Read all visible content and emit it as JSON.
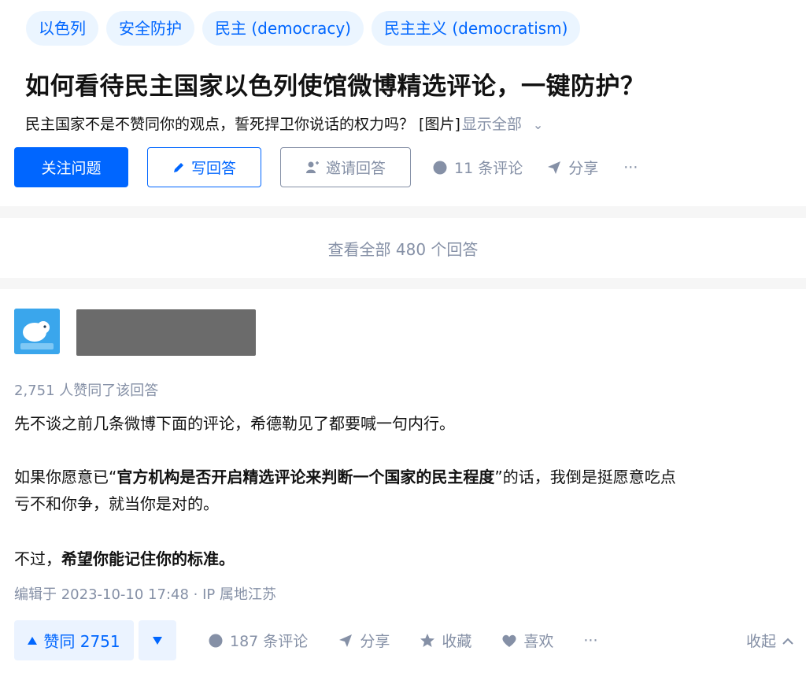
{
  "topics": [
    "以色列",
    "安全防护",
    "民主 (democracy)",
    "民主主义 (democratism)"
  ],
  "question": {
    "title": "如何看待民主国家以色列使馆微博精选评论，一键防护？",
    "detail": "民主国家不是不赞同你的观点，誓死捍卫你说话的权力吗？ [图片]",
    "show_all": "显示全部",
    "chevron": "⌄"
  },
  "actions": {
    "follow": "关注问题",
    "write": "写回答",
    "invite": "邀请回答",
    "comments": "11 条评论",
    "share": "分享",
    "more": "···"
  },
  "view_all": "查看全部 480 个回答",
  "answer": {
    "votes_line": "2,751 人赞同了该回答",
    "p1": "先不谈之前几条微博下面的评论，希德勒见了都要喊一句内行。",
    "p2_pre": "如果你愿意已“",
    "p2_bold": "官方机构是否开启精选评论来判断一个国家的民主程度",
    "p2_post": "”的话，我倒是挺愿意吃点",
    "p2_line2": "亏不和你争，就当你是对的。",
    "p3_pre": "不过，",
    "p3_bold": "希望你能记住你的标准。",
    "edit_line": "编辑于 2023-10-10 17:48 · IP 属地江苏"
  },
  "bottom": {
    "upvote": "赞同 2751",
    "comments": "187 条评论",
    "share": "分享",
    "collect": "收藏",
    "like": "喜欢",
    "more": "···",
    "collapse": "收起"
  },
  "colors": {
    "accent": "#0066ff",
    "muted": "#8590a6",
    "pill_bg": "#ebf5ff"
  }
}
